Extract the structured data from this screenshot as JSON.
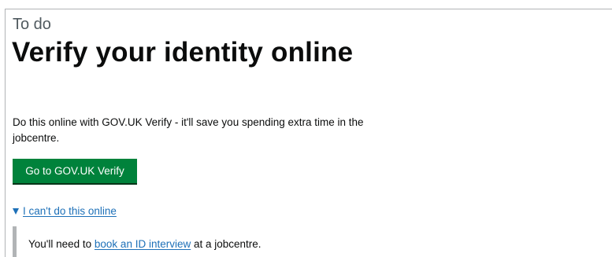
{
  "task": {
    "caption": "To do",
    "title": "Verify your identity online"
  },
  "intro": {
    "text": "Do this online with GOV.UK Verify - it'll save you spending extra time in the jobcentre."
  },
  "start_button": {
    "label": "Go to GOV.UK Verify"
  },
  "details": {
    "summary": "I can't do this online",
    "icon": "triangle-down-icon",
    "text_before": "You'll need to ",
    "link": "book an ID interview",
    "text_after": " at a jobcentre."
  },
  "colors": {
    "button_green": "#00823b",
    "link_blue": "#1d70b8",
    "text": "#0b0c0c",
    "caption_grey": "#505a5f",
    "border_grey": "#b1b4b6"
  }
}
